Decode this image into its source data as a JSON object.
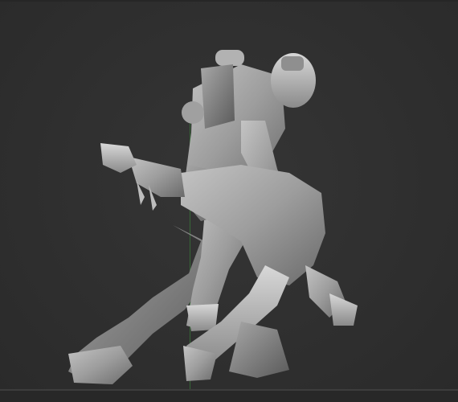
{
  "viewport": {
    "background_color": "#2e2e2e",
    "material_color": "#9a9a9a",
    "axis_color": "#3a7a3a"
  },
  "scene": {
    "subject": "sculpt-model-icon",
    "figures": [
      "large-figure",
      "carried-figure"
    ]
  }
}
